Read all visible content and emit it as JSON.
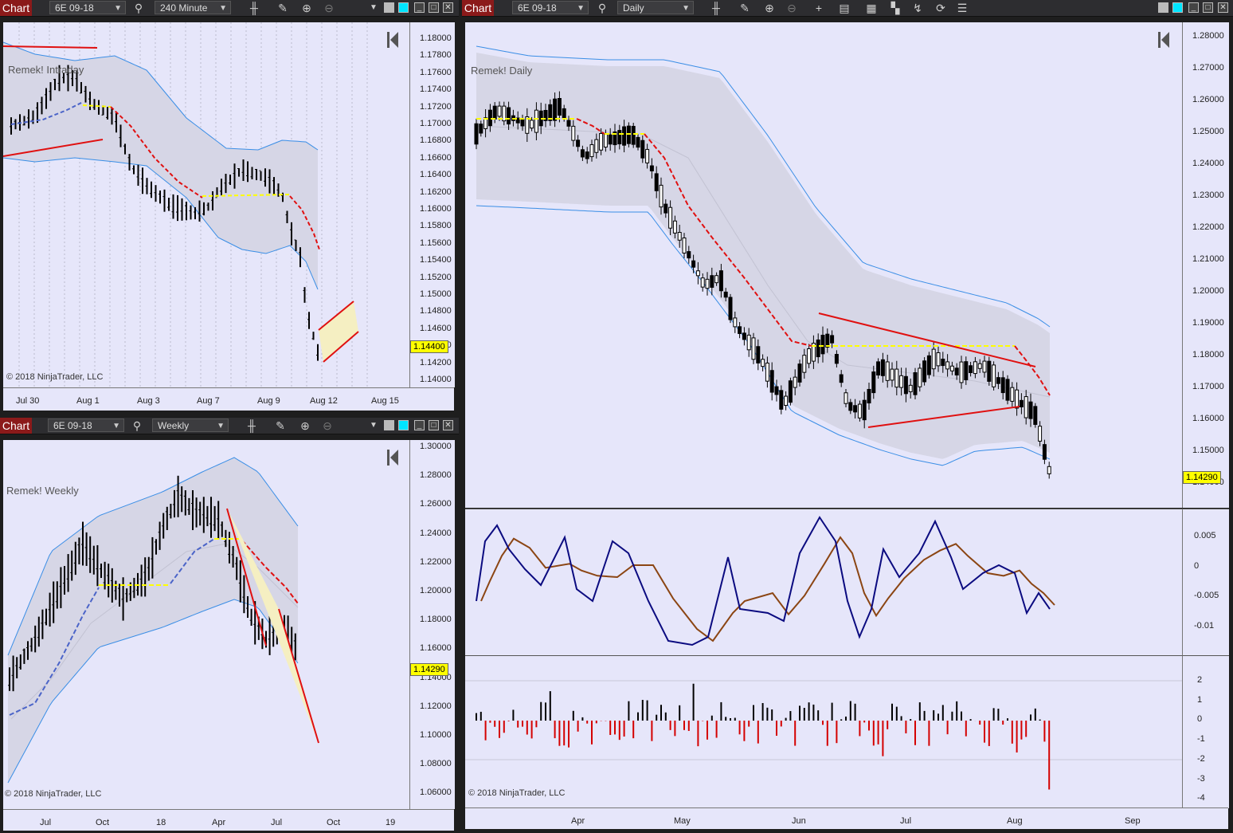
{
  "windows": {
    "intraday": {
      "chart_label": "Chart",
      "instrument": "6E 09-18",
      "interval": "240 Minute",
      "watermark": "Remek! Intraday",
      "copyright": "© 2018 NinjaTrader, LLC",
      "last_price": "1.14400",
      "y_ticks": [
        "1.18000",
        "1.17800",
        "1.17600",
        "1.17400",
        "1.17200",
        "1.17000",
        "1.16800",
        "1.16600",
        "1.16400",
        "1.16200",
        "1.16000",
        "1.15800",
        "1.15600",
        "1.15400",
        "1.15200",
        "1.15000",
        "1.14800",
        "1.14600",
        "1.14400",
        "1.14200",
        "1.14000"
      ],
      "x_ticks": [
        "Jul 30",
        "Aug 1",
        "Aug 3",
        "Aug 7",
        "Aug 9",
        "Aug 12",
        "Aug 15"
      ]
    },
    "weekly": {
      "chart_label": "Chart",
      "instrument": "6E 09-18",
      "interval": "Weekly",
      "watermark": "Remek! Weekly",
      "copyright": "© 2018 NinjaTrader, LLC",
      "last_price": "1.14290",
      "y_ticks": [
        "1.30000",
        "1.28000",
        "1.26000",
        "1.24000",
        "1.22000",
        "1.20000",
        "1.18000",
        "1.16000",
        "1.14000",
        "1.12000",
        "1.10000",
        "1.08000",
        "1.06000"
      ],
      "x_ticks": [
        "Jul",
        "Oct",
        "18",
        "Apr",
        "Jul",
        "Oct",
        "19"
      ]
    },
    "daily": {
      "chart_label": "Chart",
      "instrument": "6E 09-18",
      "interval": "Daily",
      "watermark": "Remek! Daily",
      "copyright": "© 2018 NinjaTrader, LLC",
      "last_price": "1.14290",
      "y_ticks": [
        "1.28000",
        "1.27000",
        "1.26000",
        "1.25000",
        "1.24000",
        "1.23000",
        "1.22000",
        "1.21000",
        "1.20000",
        "1.19000",
        "1.18000",
        "1.17000",
        "1.16000",
        "1.15000",
        "1.14000"
      ],
      "osc_ticks": [
        "0.005",
        "0",
        "-0.005",
        "-0.01"
      ],
      "hist_ticks": [
        "2",
        "1",
        "0",
        "-1",
        "-2",
        "-3",
        "-4"
      ],
      "x_ticks": [
        "Apr",
        "May",
        "Jun",
        "Jul",
        "Aug",
        "Sep"
      ]
    }
  },
  "colors": {
    "plot_bg": "#e6e6fa",
    "band": "#d3d3e6",
    "band_line": "#3a8ee6",
    "trend_red": "#e01010",
    "yellow": "#ffff00",
    "osc_fast": "#0b0b80",
    "osc_slow": "#8b4513",
    "hist_pos": "#000000",
    "hist_neg": "#d40000"
  }
}
